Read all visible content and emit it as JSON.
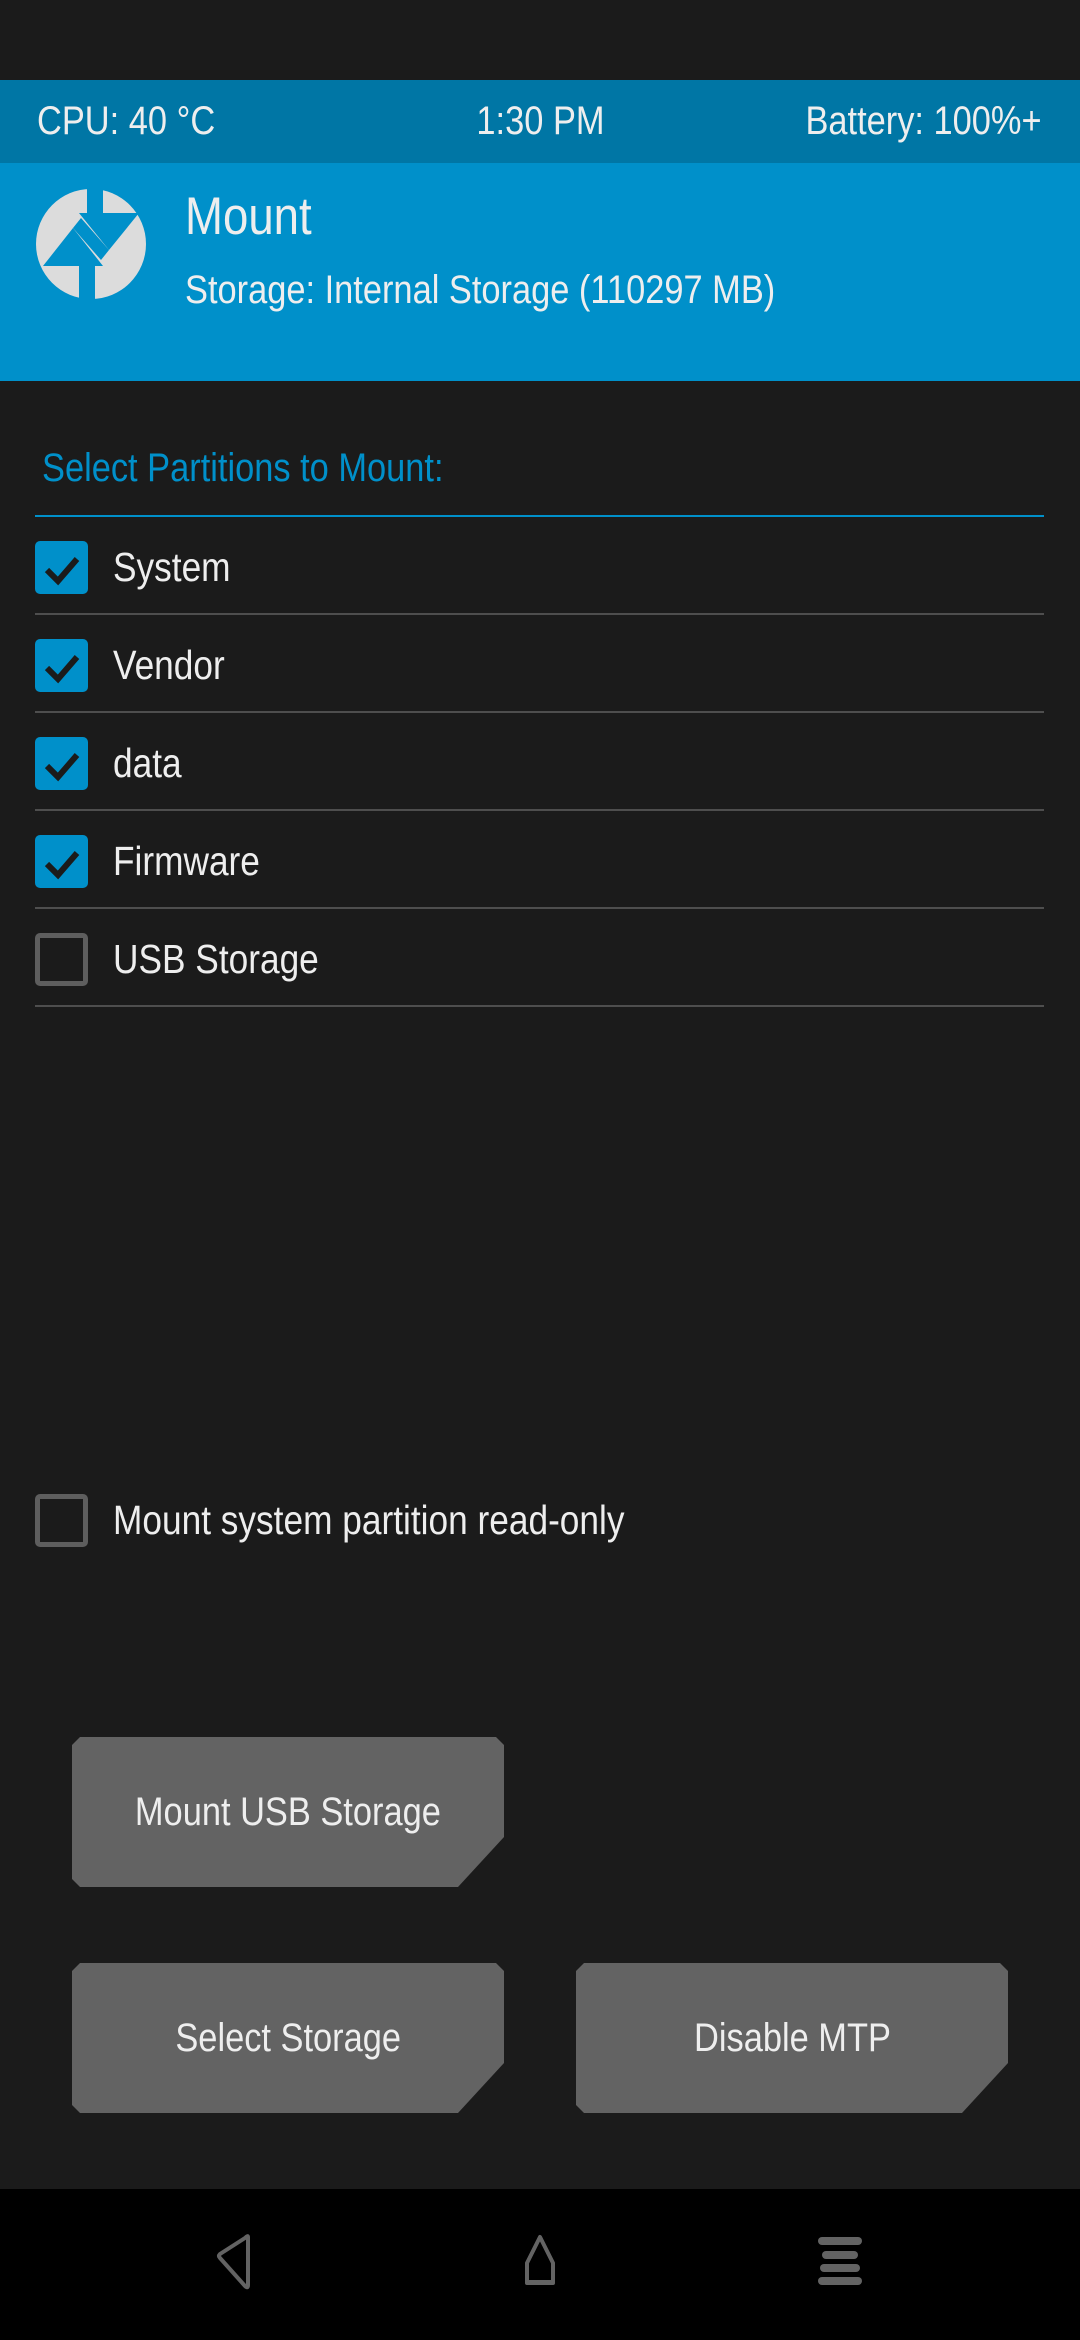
{
  "status_bar": {
    "cpu": "CPU: 40 °C",
    "time": "1:30 PM",
    "battery": "Battery: 100%+"
  },
  "header": {
    "logo_icon": "twrp-logo-icon",
    "title": "Mount",
    "subtitle": "Storage: Internal Storage (110297 MB)"
  },
  "partitions": {
    "section_title": "Select Partitions to Mount:",
    "items": [
      {
        "label": "System",
        "checked": true
      },
      {
        "label": "Vendor",
        "checked": true
      },
      {
        "label": "data",
        "checked": true
      },
      {
        "label": "Firmware",
        "checked": true
      },
      {
        "label": "USB Storage",
        "checked": false
      }
    ]
  },
  "options": {
    "readonly_label": "Mount system partition read-only",
    "readonly_checked": false
  },
  "buttons": {
    "mount_usb": "Mount USB Storage",
    "select_storage": "Select Storage",
    "disable_mtp": "Disable MTP"
  },
  "navbar": {
    "back_icon": "back-icon",
    "home_icon": "home-icon",
    "menu_icon": "menu-icon"
  },
  "colors": {
    "accent": "#0090ca",
    "status_bar": "#0076a5",
    "background": "#1b1b1b",
    "button": "#636363",
    "checkbox_off": "#5e5e5e"
  }
}
